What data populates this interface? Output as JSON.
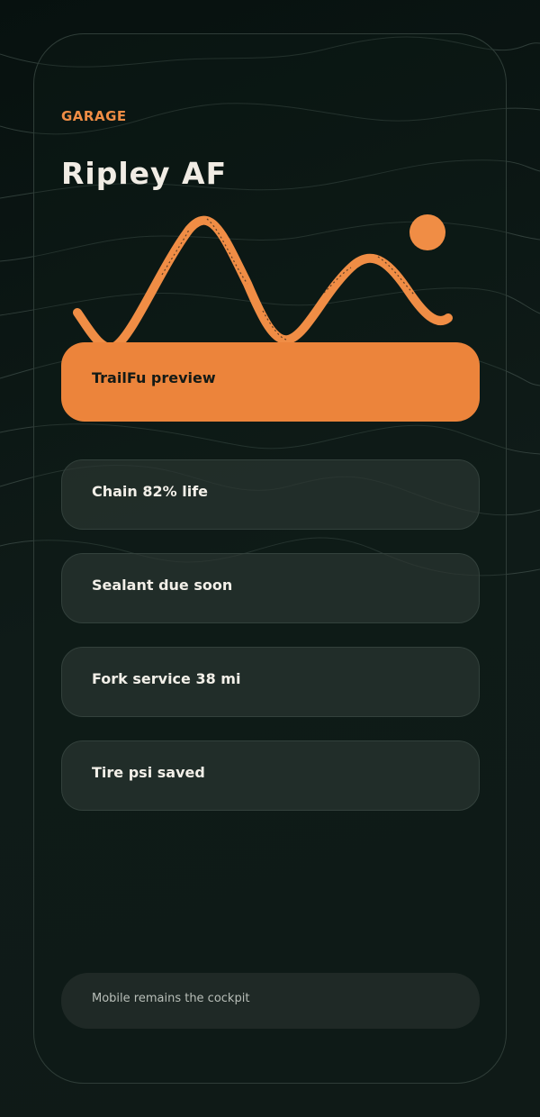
{
  "header": {
    "eyebrow": "GARAGE",
    "title": "Ripley AF"
  },
  "primary_action": {
    "label": "TrailFu preview"
  },
  "status_cards": [
    {
      "label": "Chain 82% life"
    },
    {
      "label": "Sealant due soon"
    },
    {
      "label": "Fork service 38 mi"
    },
    {
      "label": "Tire psi saved"
    }
  ],
  "footer": {
    "label": "Mobile remains the cockpit"
  },
  "colors": {
    "accent": "#f08d45",
    "background": "#0b1714",
    "card": "#26322e",
    "text": "#f1ece4"
  },
  "icons": {
    "trail_art": "trail-line-sun-illustration"
  }
}
